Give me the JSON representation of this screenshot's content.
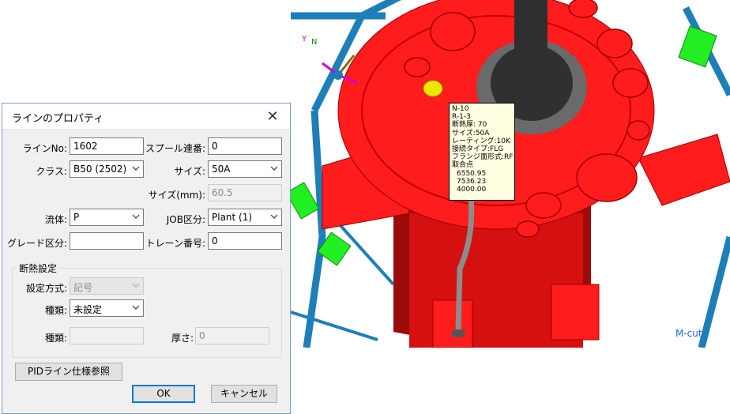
{
  "dialog": {
    "title": "ラインのプロパティ",
    "close_glyph": "✕",
    "fields": {
      "line_no_label": "ラインNo:",
      "line_no_value": "1602",
      "spool_label": "スプール連番:",
      "spool_value": "0",
      "class_label": "クラス:",
      "class_value": "B50 (2502)",
      "size_label": "サイズ:",
      "size_value": "50A",
      "size_mm_label": "サイズ(mm):",
      "size_mm_value": "60.5",
      "fluid_label": "流体:",
      "fluid_value": "P",
      "job_label": "JOB区分:",
      "job_value": "Plant (1)",
      "grade_label": "グレード区分:",
      "grade_value": "",
      "train_label": "トレーン番号:",
      "train_value": "0"
    },
    "insulation": {
      "group_title": "断熱設定",
      "method_label": "設定方式:",
      "method_value": "記号",
      "type_label": "種類:",
      "type_value": "未設定",
      "type2_label": "種類:",
      "type2_value": "",
      "thickness_label": "厚さ:",
      "thickness_value": "0"
    },
    "buttons": {
      "pid": "PIDライン仕様参照",
      "ok": "OK",
      "cancel": "キャンセル"
    }
  },
  "viewport": {
    "axis_y": "Y",
    "axis_n": "N",
    "mcut_label": "M-cut",
    "tooltip_lines": [
      "N-10",
      "R-1-3",
      "断熱厚: 70",
      "サイズ:50A",
      "レーティング:10K",
      "接続タイプ:FLG",
      "フランジ面形式:RF",
      "取合点"
    ],
    "tooltip_coords": [
      "6550.95",
      "7536.23",
      "4000.00"
    ]
  },
  "colors": {
    "vessel_red": "#ff1c1c",
    "frame_blue": "#1e7fb8",
    "marker_green": "#22ee22",
    "dialog_border": "#7a9cc8",
    "default_button": "#0078d7"
  }
}
